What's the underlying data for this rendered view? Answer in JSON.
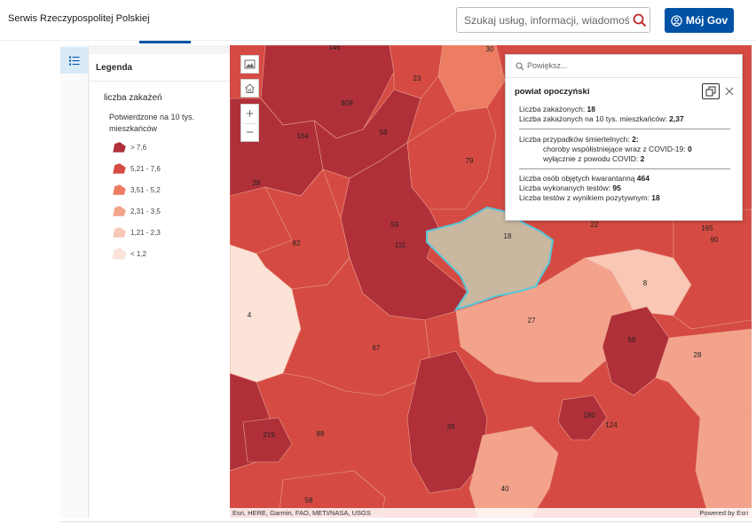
{
  "header": {
    "site_name": "Serwis Rzeczypospolitej Polskiej",
    "search_placeholder": "Szukaj usług, informacji, wiadomości",
    "mojgov_label": "Mój Gov"
  },
  "legend": {
    "title": "Legenda",
    "layer": "liczba zakażeń",
    "field": "Potwierdzone na 10 tys. mieszkańców",
    "classes": [
      {
        "label": "> 7,6",
        "color": "#b0303a"
      },
      {
        "label": "5,21 - 7,6",
        "color": "#d54b43"
      },
      {
        "label": "3,51 - 5,2",
        "color": "#ec7c62"
      },
      {
        "label": "2,31 - 3,5",
        "color": "#f3a38b"
      },
      {
        "label": "1,21 - 2,3",
        "color": "#f8c7b5"
      },
      {
        "label": "< 1,2",
        "color": "#fce3d8"
      }
    ]
  },
  "map": {
    "region_labels": [
      {
        "text": "146"
      },
      {
        "text": "30"
      },
      {
        "text": "23"
      },
      {
        "text": "609"
      },
      {
        "text": "58"
      },
      {
        "text": "164"
      },
      {
        "text": "79"
      },
      {
        "text": "28"
      },
      {
        "text": "59"
      },
      {
        "text": "111"
      },
      {
        "text": "82"
      },
      {
        "text": "18"
      },
      {
        "text": "22"
      },
      {
        "text": "165"
      },
      {
        "text": "90"
      },
      {
        "text": "8"
      },
      {
        "text": "4"
      },
      {
        "text": "27"
      },
      {
        "text": "58"
      },
      {
        "text": "67"
      },
      {
        "text": "28"
      },
      {
        "text": "39"
      },
      {
        "text": "180"
      },
      {
        "text": "124"
      },
      {
        "text": "219"
      },
      {
        "text": "88"
      },
      {
        "text": "40"
      },
      {
        "text": "58"
      }
    ],
    "attribution": "Esri, HERE, Garmin, FAO, METI/NASA, USGS",
    "powered_by": "Powered by Esri"
  },
  "popup": {
    "search_placeholder": "Powiększ...",
    "title": "powiat opoczyński",
    "lines1": [
      {
        "label": "Liczba zakażonych: ",
        "value": "18"
      },
      {
        "label": "Liczba zakażonych na 10 tys. mieszkańców: ",
        "value": "2,37"
      }
    ],
    "deaths_label": "Liczba przypadków śmiertelnych: ",
    "deaths_value": "2:",
    "comorbid_label": "choroby współistniejące wraz z COVID-19: ",
    "comorbid_value": "0",
    "covid_only_label": "wyłącznie z powodu COVID: ",
    "covid_only_value": "2",
    "lines3": [
      {
        "label": "Liczba osób objętych kwarantanną ",
        "value": "464"
      },
      {
        "label": "Liczba wykonanych testów: ",
        "value": "95"
      },
      {
        "label": "Liczba testów z wynikiem pozytywnym: ",
        "value": "18"
      }
    ]
  },
  "colors": {
    "brand_blue": "#0052a5",
    "selected_fill": "#c9b7a0",
    "selected_outline": "#56c7d8"
  }
}
